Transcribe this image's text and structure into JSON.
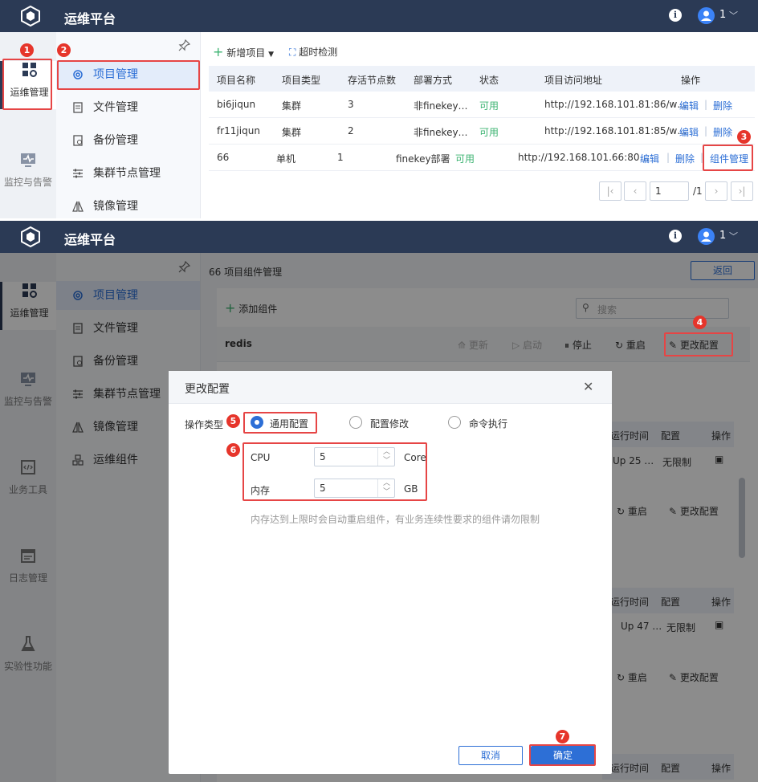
{
  "top": {
    "header": {
      "title": "运维平台",
      "user": "1"
    },
    "rail": [
      {
        "label": "运维管理",
        "icon": "apps-gear-icon"
      },
      {
        "label": "监控与告警",
        "icon": "monitor-icon"
      }
    ],
    "menu": [
      {
        "label": "项目管理",
        "icon": "gear-icon"
      },
      {
        "label": "文件管理",
        "icon": "file-icon"
      },
      {
        "label": "备份管理",
        "icon": "backup-icon"
      },
      {
        "label": "集群节点管理",
        "icon": "sliders-icon"
      },
      {
        "label": "镜像管理",
        "icon": "mirror-icon"
      }
    ],
    "toolbar": {
      "new_project": "新增项目",
      "timeout_check": "超时检测"
    },
    "table": {
      "headers": [
        "项目名称",
        "项目类型",
        "存活节点数",
        "部署方式",
        "状态",
        "项目访问地址",
        "操作"
      ],
      "rows": [
        {
          "name": "bi6jiqun",
          "type": "集群",
          "nodes": "3",
          "deploy": "非finekey…",
          "status": "可用",
          "url": "http://192.168.101.81:86/w…",
          "actions": [
            "编辑",
            "删除"
          ]
        },
        {
          "name": "fr11jiqun",
          "type": "集群",
          "nodes": "2",
          "deploy": "非finekey…",
          "status": "可用",
          "url": "http://192.168.101.81:85/w…",
          "actions": [
            "编辑",
            "删除"
          ]
        },
        {
          "name": "66",
          "type": "单机",
          "nodes": "1",
          "deploy": "finekey部署",
          "status": "可用",
          "url": "http://192.168.101.66:80…",
          "actions": [
            "编辑",
            "删除",
            "组件管理"
          ]
        }
      ]
    },
    "pagination": {
      "page": "1",
      "total": "/1"
    },
    "markers": [
      "1",
      "2",
      "3"
    ]
  },
  "bottom": {
    "header": {
      "title": "运维平台",
      "user": "1"
    },
    "rail": [
      {
        "label": "运维管理",
        "icon": "apps-gear-icon"
      },
      {
        "label": "监控与告警",
        "icon": "monitor-icon"
      },
      {
        "label": "业务工具",
        "icon": "code-icon"
      },
      {
        "label": "日志管理",
        "icon": "calendar-icon"
      },
      {
        "label": "实验性功能",
        "icon": "flask-icon"
      }
    ],
    "menu": [
      {
        "label": "项目管理",
        "icon": "gear-icon"
      },
      {
        "label": "文件管理",
        "icon": "file-icon"
      },
      {
        "label": "备份管理",
        "icon": "backup-icon"
      },
      {
        "label": "集群节点管理",
        "icon": "sliders-icon"
      },
      {
        "label": "镜像管理",
        "icon": "mirror-icon"
      },
      {
        "label": "运维组件",
        "icon": "components-icon"
      }
    ],
    "page_title": "66 项目组件管理",
    "back": "返回",
    "add_component": "添加组件",
    "search_placeholder": "搜索",
    "component": {
      "name": "redis",
      "actions": [
        "更新",
        "启动",
        "停止",
        "重启",
        "更改配置"
      ]
    },
    "bg_table": {
      "headers": [
        "运行时间",
        "配置",
        "操作"
      ],
      "rows": [
        {
          "uptime": "Up 25 …",
          "config": "无限制"
        },
        {
          "uptime": "Up 47 …",
          "config": "无限制"
        }
      ],
      "card_actions": [
        "重启",
        "更改配置"
      ]
    },
    "dialog": {
      "title": "更改配置",
      "op_type_label": "操作类型",
      "options": [
        "通用配置",
        "配置修改",
        "命令执行"
      ],
      "selected": "通用配置",
      "cpu_label": "CPU",
      "cpu_value": "5",
      "cpu_unit": "Core",
      "mem_label": "内存",
      "mem_value": "5",
      "mem_unit": "GB",
      "hint": "内存达到上限时会自动重启组件，有业务连续性要求的组件请勿限制",
      "cancel": "取消",
      "confirm": "确定"
    },
    "markers": [
      "4",
      "5",
      "6",
      "7"
    ]
  },
  "colors": {
    "header": "#2b3a55",
    "accent": "#2d6fd6",
    "marker": "#e6352b",
    "status_ok": "#3cb371"
  }
}
